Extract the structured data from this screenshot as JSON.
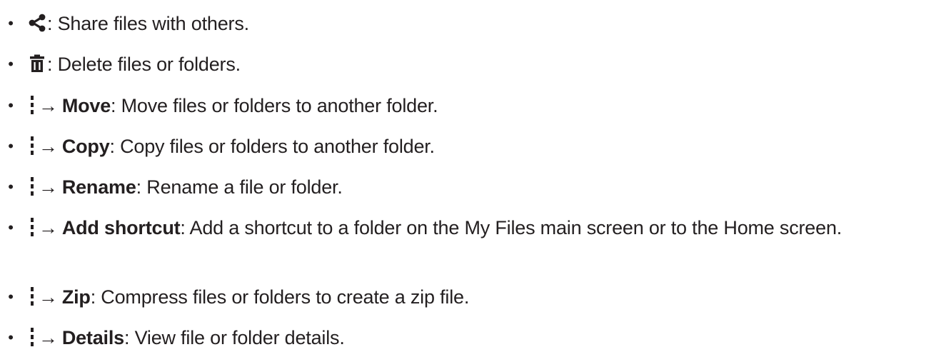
{
  "items": [
    {
      "icon": "share-icon",
      "text": ": Share files with others."
    },
    {
      "icon": "trash-icon",
      "text": ": Delete files or folders."
    },
    {
      "icon": "more-options-icon",
      "arrow": "→",
      "label": "Move",
      "text": ": Move files or folders to another folder."
    },
    {
      "icon": "more-options-icon",
      "arrow": "→",
      "label": "Copy",
      "text": ": Copy files or folders to another folder."
    },
    {
      "icon": "more-options-icon",
      "arrow": "→",
      "label": "Rename",
      "text": ": Rename a file or folder."
    },
    {
      "icon": "more-options-icon",
      "arrow": "→",
      "label": "Add shortcut",
      "text": ": Add a shortcut to a folder on the My Files main screen or to the Home screen."
    },
    {
      "icon": "more-options-icon",
      "arrow": "→",
      "label": "Zip",
      "text": ": Compress files or folders to create a zip file."
    },
    {
      "icon": "more-options-icon",
      "arrow": "→",
      "label": "Details",
      "text": ": View file or folder details."
    }
  ],
  "bullet": "•"
}
